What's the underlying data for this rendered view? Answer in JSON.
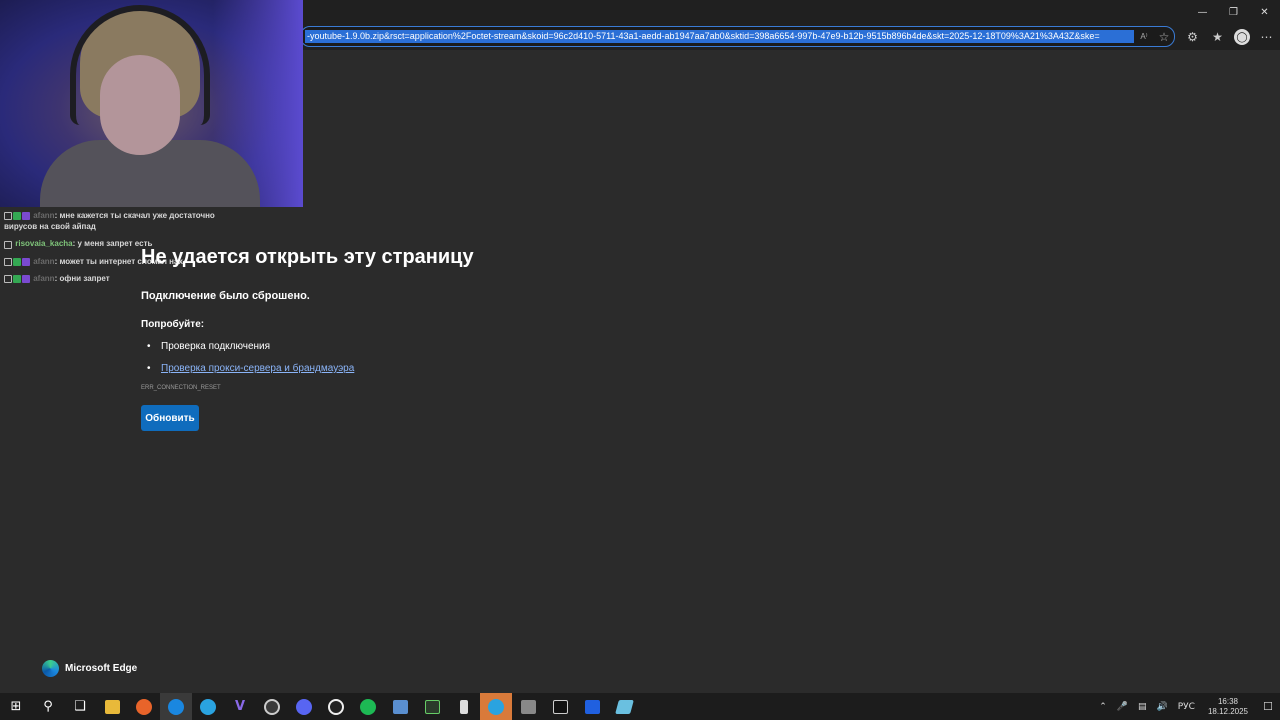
{
  "browser": {
    "url": "-youtube-1.9.0b.zip&rsct=application%2Foctet-stream&skoid=96c2d410-5711-43a1-aedd-ab1947aa7ab0&sktid=398a6654-997b-47e9-b12b-9515b896b4de&skt=2025-12-18T09%3A21%3A43Z&ske=",
    "read_aloud": "A⁾"
  },
  "chat": {
    "messages": [
      {
        "user": "afann",
        "text": ": мне кажется ты скачал уже достаточно вирусов на свой айпад",
        "green": false
      },
      {
        "user": "risovaia_kacha",
        "text": ": у меня запрет есть",
        "green": true
      },
      {
        "user": "afann",
        "text": ": может ты интернет сломал нах",
        "green": false
      },
      {
        "user": "afann",
        "text": ": офни запрет",
        "green": false
      }
    ]
  },
  "error_page": {
    "title": "Не удается открыть эту страницу",
    "subtitle": "Подключение было сброшено.",
    "try_label": "Попробуйте:",
    "suggestion_1": "Проверка подключения",
    "suggestion_2": "Проверка прокси-сервера и брандмауэра",
    "error_code": "ERR_CONNECTION_RESET",
    "reload_button": "Обновить"
  },
  "notification": {
    "app_name": "Microsoft Edge"
  },
  "taskbar": {
    "lang": "РУС",
    "time": "16:38",
    "date": "18.12.2025"
  },
  "colors": {
    "accent": "#0f6cbd",
    "link": "#8ab4f8",
    "page_bg": "#2b2b2b"
  }
}
